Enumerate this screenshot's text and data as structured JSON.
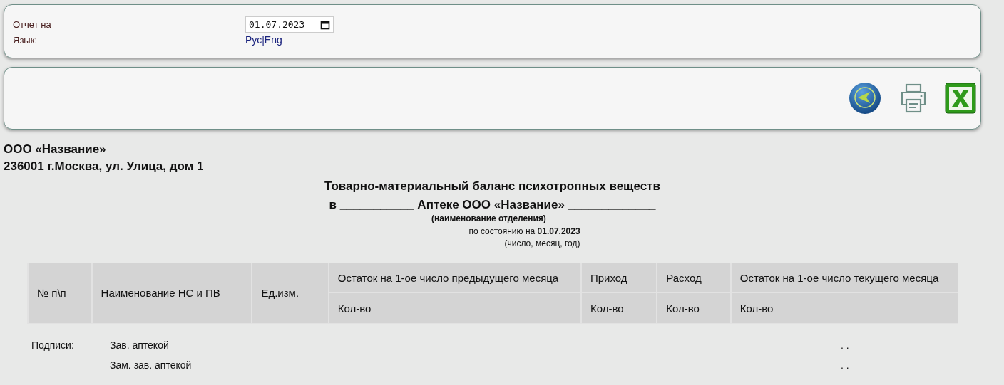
{
  "filters": {
    "date_label": "Отчет на",
    "date_value": "01.07.2023",
    "language_label": "Язык:",
    "languages": [
      {
        "label": "Рус"
      },
      {
        "label": "Eng"
      }
    ],
    "language_separator": "|"
  },
  "toolbar": {
    "buttons": [
      {
        "kind": "back"
      },
      {
        "kind": "print"
      },
      {
        "kind": "excel"
      }
    ]
  },
  "org": {
    "name": "ООО «Название»",
    "address": "236001 г.Москва, ул. Улица, дом 1"
  },
  "report": {
    "title_line_1": "Товарно-материальный баланс психотропных веществ",
    "title_line_2": "в ___________ Аптеке ООО «Название» _____________",
    "department_hint": "(наименование отделения)",
    "as_of_prefix": "по состоянию на",
    "as_of_date": "01.07.2023",
    "date_hint": "(число, месяц, год)"
  },
  "table": {
    "columns": [
      {
        "label": "№ п\\п"
      },
      {
        "label": "Наименование НС и ПВ"
      },
      {
        "label": "Ед.изм."
      },
      {
        "label": "Остаток на 1-ое число предыдущего месяца",
        "sub": "Кол-во"
      },
      {
        "label": "Приход",
        "sub": "Кол-во"
      },
      {
        "label": "Расход",
        "sub": "Кол-во"
      },
      {
        "label": "Остаток на 1-ое число текущего месяца",
        "sub": "Кол-во"
      }
    ]
  },
  "signatures": {
    "label": "Подписи:",
    "rows": [
      {
        "role": "Зав. аптекой",
        "value": ". ."
      },
      {
        "role": "Зам. зав. аптекой",
        "value": ". ."
      }
    ]
  }
}
